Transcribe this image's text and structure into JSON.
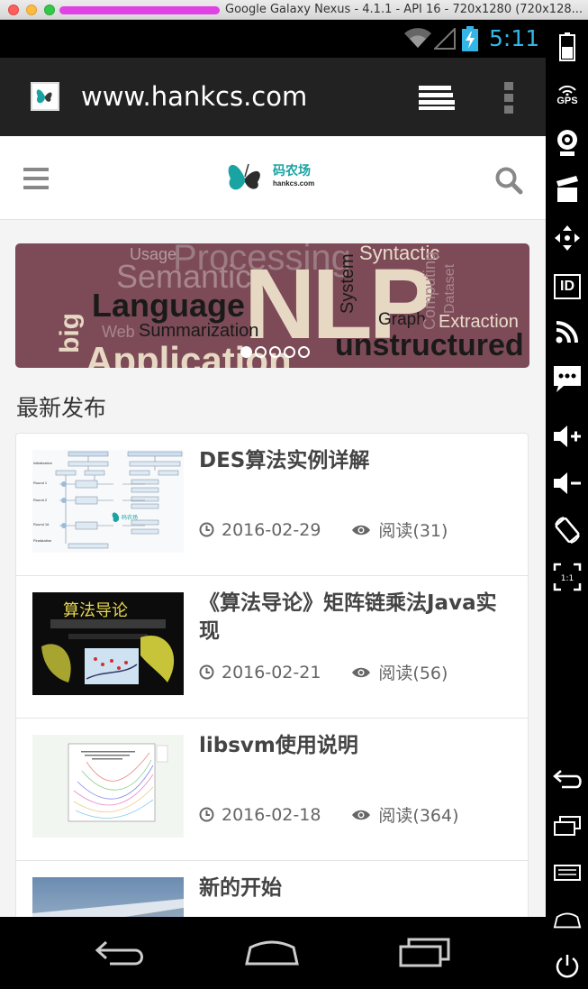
{
  "window": {
    "title": "Google Galaxy Nexus - 4.1.1 - API 16 - 720x1280 (720x128..."
  },
  "statusbar": {
    "time": "5:11"
  },
  "browser": {
    "url": "www.hankcs.com"
  },
  "site": {
    "logo_cn": "码农场",
    "logo_en": "hankcs.com"
  },
  "banner": {
    "words": [
      "Processing",
      "Syntactic",
      "Usage",
      "Semantic",
      "Language",
      "NLP",
      "System",
      "Graph",
      "Computing",
      "Dataset",
      "Extraction",
      "big",
      "Web",
      "Summarization",
      "unstructured",
      "Application"
    ],
    "slides": 5,
    "active_slide": 1
  },
  "section": {
    "title": "最新发布"
  },
  "posts": [
    {
      "title": "DES算法实例详解",
      "date": "2016-02-29",
      "reads": "阅读(31)"
    },
    {
      "title": "《算法导论》矩阵链乘法Java实现",
      "date": "2016-02-21",
      "reads": "阅读(56)"
    },
    {
      "title": "libsvm使用说明",
      "date": "2016-02-18",
      "reads": "阅读(364)"
    },
    {
      "title": "新的开始",
      "date": "",
      "reads": ""
    }
  ],
  "thumbs": {
    "des_caption": "码农场",
    "book_title": "算法导论"
  },
  "sidebar": {
    "gps_label": "GPS",
    "id_label": "ID",
    "zoom_label": "1:1"
  }
}
